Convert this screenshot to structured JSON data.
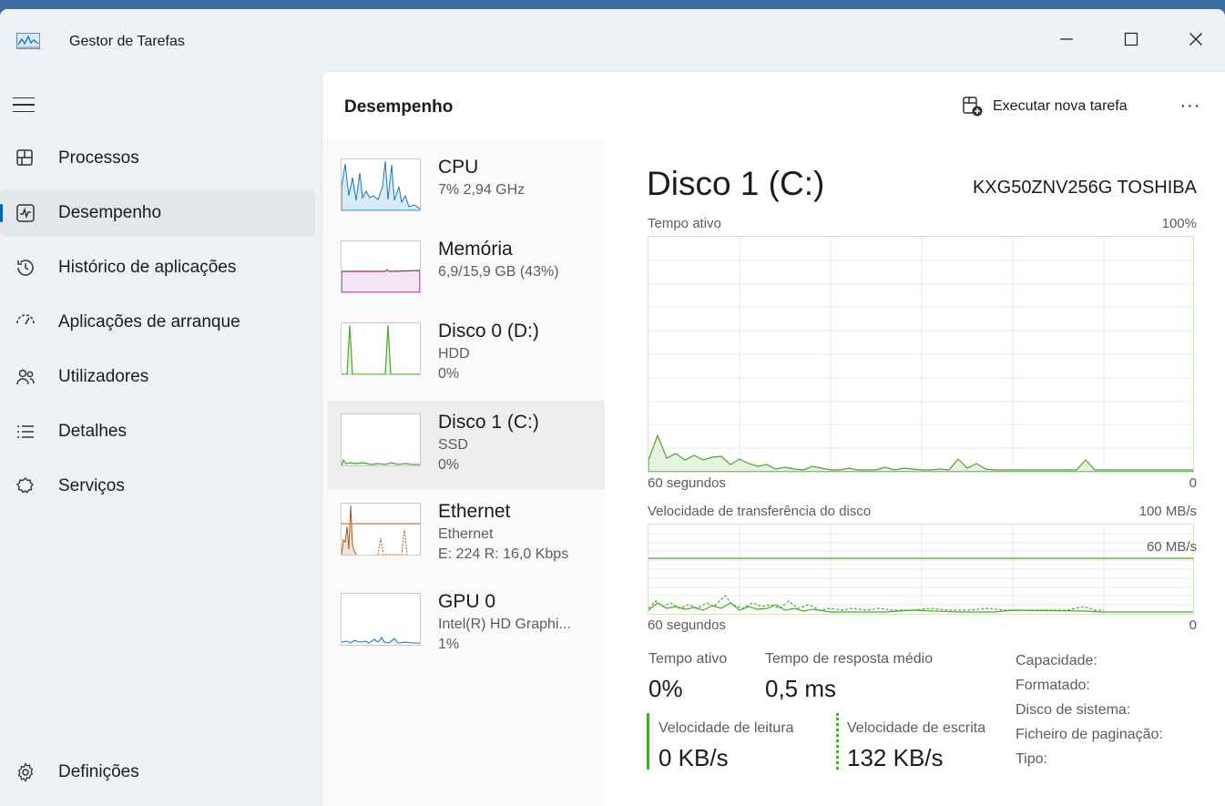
{
  "app": {
    "title": "Gestor de Tarefas"
  },
  "nav": {
    "items": [
      {
        "label": "Processos",
        "icon": "processes-icon"
      },
      {
        "label": "Desempenho",
        "icon": "performance-icon",
        "active": true
      },
      {
        "label": "Histórico de aplicações",
        "icon": "history-icon"
      },
      {
        "label": "Aplicações de arranque",
        "icon": "startup-icon"
      },
      {
        "label": "Utilizadores",
        "icon": "users-icon"
      },
      {
        "label": "Detalhes",
        "icon": "details-icon"
      },
      {
        "label": "Serviços",
        "icon": "services-icon"
      }
    ],
    "settings": {
      "label": "Definições",
      "icon": "gear-icon"
    }
  },
  "header": {
    "title": "Desempenho",
    "run_task": "Executar nova tarefa",
    "more": "···"
  },
  "resources": [
    {
      "name": "CPU",
      "sub1": "7%  2,94 GHz",
      "sub2": "",
      "color": "#1978b8"
    },
    {
      "name": "Memória",
      "sub1": "6,9/15,9 GB (43%)",
      "sub2": "",
      "color": "#8b2a8b"
    },
    {
      "name": "Disco 0 (D:)",
      "sub1": "HDD",
      "sub2": "0%",
      "color": "#4ca72f"
    },
    {
      "name": "Disco 1 (C:)",
      "sub1": "SSD",
      "sub2": "0%",
      "color": "#4ca72f",
      "selected": true
    },
    {
      "name": "Ethernet",
      "sub1": "Ethernet",
      "sub2": "E: 224  R: 16,0 Kbps",
      "color": "#a7571a"
    },
    {
      "name": "GPU 0",
      "sub1": "Intel(R) HD Graphi...",
      "sub2": "1%",
      "color": "#1978b8"
    }
  ],
  "detail": {
    "title": "Disco 1 (C:)",
    "model": "KXG50ZNV256G TOSHIBA",
    "graph1": {
      "label": "Tempo ativo",
      "max": "100%",
      "time": "60 segundos",
      "min": "0"
    },
    "graph2": {
      "label": "Velocidade de transferência do disco",
      "max": "100 MB/s",
      "mid": "60 MB/s",
      "time": "60 segundos",
      "min": "0"
    },
    "stats": {
      "active_label": "Tempo ativo",
      "active_value": "0%",
      "response_label": "Tempo de resposta médio",
      "response_value": "0,5 ms",
      "read_label": "Velocidade de leitura",
      "read_value": "0 KB/s",
      "write_label": "Velocidade de escrita",
      "write_value": "132 KB/s"
    },
    "properties": [
      "Capacidade:",
      "Formatado:",
      "Disco de sistema:",
      "Ficheiro de paginação:",
      "Tipo:"
    ]
  },
  "colors": {
    "accent": "#005fb8",
    "disk": "#4ca72f",
    "disk_grid": "#cfe5c5"
  }
}
